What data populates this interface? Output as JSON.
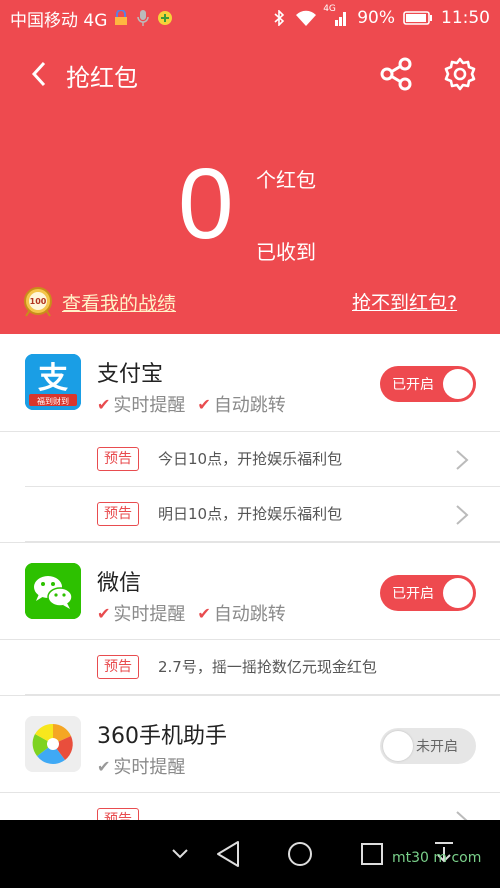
{
  "status_bar": {
    "carrier": "中国移动 4G",
    "battery": "90%",
    "time": "11:50",
    "signal_label": "4G",
    "icons": [
      "lock-icon",
      "mic-icon",
      "app-notification-icon",
      "bluetooth-icon",
      "wifi-icon",
      "signal-icon",
      "battery-icon"
    ]
  },
  "header": {
    "title": "抢红包",
    "count": "0",
    "count_unit": "个红包",
    "count_caption": "已收到",
    "record_link": "查看我的战绩",
    "medal_text": "100",
    "cant_link": "抢不到红包?",
    "bg_color": "#ee4a4f"
  },
  "apps": [
    {
      "name": "支付宝",
      "features": [
        "实时提醒",
        "自动跳转"
      ],
      "toggle": "已开启",
      "toggle_on": true,
      "icon_text": "支",
      "icon_caption": "福到财到",
      "notices": [
        {
          "badge": "预告",
          "text": "今日10点，开抢娱乐福利包"
        },
        {
          "badge": "预告",
          "text": "明日10点，开抢娱乐福利包"
        }
      ]
    },
    {
      "name": "微信",
      "features": [
        "实时提醒",
        "自动跳转"
      ],
      "toggle": "已开启",
      "toggle_on": true,
      "notices": [
        {
          "badge": "预告",
          "text": "2.7号，摇一摇抢数亿元现金红包"
        }
      ]
    },
    {
      "name": "360手机助手",
      "features": [
        "实时提醒"
      ],
      "toggle": "未开启",
      "toggle_on": false,
      "notices": [
        {
          "badge": "预告",
          "text": ""
        }
      ]
    }
  ],
  "navbar": {
    "buttons": [
      "hide-icon",
      "back-icon",
      "home-icon",
      "recents-icon",
      "notification-pull-icon"
    ]
  },
  "watermark": "mt30 m com",
  "colors": {
    "accent": "#ee4a4f",
    "alipay": "#1a9ee5",
    "wechat": "#2dc100"
  }
}
